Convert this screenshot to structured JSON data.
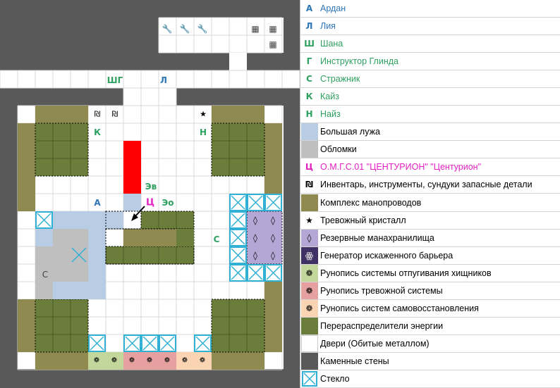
{
  "map": {
    "labels": {
      "shg": "ШГ",
      "l": "Л",
      "k": "К",
      "n": "Н",
      "ev": "Эв",
      "eo": "Эо",
      "a": "А",
      "ts": "Ц",
      "s_right": "С",
      "s_left": "С"
    }
  },
  "legend": {
    "items": [
      {
        "symbol": "А",
        "text": "Ардан",
        "color": "#2e75b6"
      },
      {
        "symbol": "Л",
        "text": "Лия",
        "color": "#2e75b6"
      },
      {
        "symbol": "Ш",
        "text": "Шана",
        "color": "#2ea060"
      },
      {
        "symbol": "Г",
        "text": "Инструктор Глинда",
        "color": "#2ea060"
      },
      {
        "symbol": "С",
        "text": "Стражник",
        "color": "#2ea060"
      },
      {
        "symbol": "К",
        "text": "Кайз",
        "color": "#2ea060"
      },
      {
        "symbol": "Н",
        "text": "Найз",
        "color": "#2ea060"
      },
      {
        "symbol": "",
        "text": "Большая лужа",
        "color": "#b8cce4"
      },
      {
        "symbol": "",
        "text": "Обломки",
        "color": "#bfbfbf"
      },
      {
        "symbol": "Ц",
        "text": "О.М.Г.С.01 \"ЦЕНТУРИОН\" \"Центурион\"",
        "color": "#e020c0"
      },
      {
        "symbol": "₪",
        "text": "Инвентарь, инструменты, сундуки запасные детали",
        "color": "#000000"
      },
      {
        "symbol": "",
        "text": "Комплекс манопроводов",
        "color": "#8f8a50"
      },
      {
        "symbol": "★",
        "text": "Тревожный кристалл",
        "color": "#000000"
      },
      {
        "symbol": "◊",
        "text": "Резервные манахранилища",
        "color": "#b4a7d6"
      },
      {
        "symbol": "ꙮ",
        "text": "Генератор искаженного барьера",
        "color": "#3f3163"
      },
      {
        "symbol": "❁",
        "text": "Рунопись системы отпугивания хищников",
        "color": "#c3d69b"
      },
      {
        "symbol": "❁",
        "text": "Рунопись тревожной системы",
        "color": "#e6a0a0"
      },
      {
        "symbol": "❁",
        "text": "Рунопись систем самовосстановления",
        "color": "#fbd4b4"
      },
      {
        "symbol": "",
        "text": "Перераспределители энергии",
        "color": "#6b7d3a"
      },
      {
        "symbol": "",
        "text": "Двери (Обитые металлом)",
        "color": "#ffffff"
      },
      {
        "symbol": "",
        "text": "Каменные стены",
        "color": "#595959"
      },
      {
        "symbol": "",
        "text": "Стекло",
        "color": "#31b0d5"
      }
    ]
  },
  "colors": {
    "wall": "#595959",
    "floor": "#ffffff",
    "puddle": "#b8cce4",
    "debris": "#bfbfbf",
    "pipes": "#8f8a50",
    "energy": "#6b7d3a",
    "reserve": "#b4a7d6",
    "glass": "#31b0d5",
    "red_block": "#ff0000",
    "rune_green": "#c3d69b",
    "rune_red": "#e6a0a0",
    "rune_peach": "#fbd4b4"
  }
}
